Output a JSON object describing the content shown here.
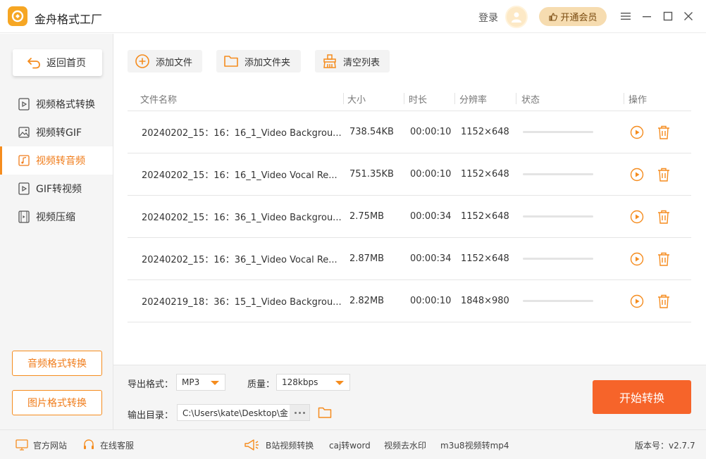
{
  "app": {
    "title": "金舟格式工厂"
  },
  "header": {
    "login_label": "登录",
    "vip_label": "开通会员"
  },
  "sidebar": {
    "back_label": "返回首页",
    "items": [
      {
        "label": "视频格式转换",
        "active": false
      },
      {
        "label": "视频转GIF",
        "active": false
      },
      {
        "label": "视频转音频",
        "active": true
      },
      {
        "label": "GIF转视频",
        "active": false
      },
      {
        "label": "视频压缩",
        "active": false
      }
    ],
    "audio_convert_label": "音频格式转换",
    "image_convert_label": "图片格式转换"
  },
  "toolbar": {
    "add_file_label": "添加文件",
    "add_folder_label": "添加文件夹",
    "clear_list_label": "清空列表"
  },
  "table": {
    "columns": [
      "文件名称",
      "大小",
      "时长",
      "分辨率",
      "状态",
      "操作"
    ],
    "rows": [
      {
        "name": "20240202_15：16：16_1_Video Backgrou...",
        "size": "738.54KB",
        "duration": "00:00:10",
        "resolution": "1152×648",
        "progress": 0
      },
      {
        "name": "20240202_15：16：16_1_Video Vocal Re...",
        "size": "751.35KB",
        "duration": "00:00:10",
        "resolution": "1152×648",
        "progress": 0
      },
      {
        "name": "20240202_15：16：36_1_Video Backgrou...",
        "size": "2.75MB",
        "duration": "00:00:34",
        "resolution": "1152×648",
        "progress": 0
      },
      {
        "name": "20240202_15：16：36_1_Video Vocal Re...",
        "size": "2.87MB",
        "duration": "00:00:34",
        "resolution": "1152×648",
        "progress": 0
      },
      {
        "name": "20240219_18：36：15_1_Video Backgrou...",
        "size": "2.82MB",
        "duration": "00:00:10",
        "resolution": "1848×980",
        "progress": 0
      }
    ]
  },
  "output": {
    "format_label": "导出格式：",
    "format_value": "MP3",
    "quality_label": "质量：",
    "quality_value": "128kbps",
    "dir_label": "输出目录：",
    "dir_value": "C:\\Users\\kate\\Desktop\\金",
    "start_label": "开始转换"
  },
  "footer": {
    "website_label": "官方网站",
    "support_label": "在线客服",
    "links": [
      "B站视频转换",
      "caj转word",
      "视频去水印",
      "m3u8视频转mp4"
    ],
    "version_label": "版本号：v2.7.7"
  },
  "colors": {
    "accent": "#f58c1e",
    "start_button": "#f6642a",
    "vip_bg": "#f6dcb0"
  }
}
